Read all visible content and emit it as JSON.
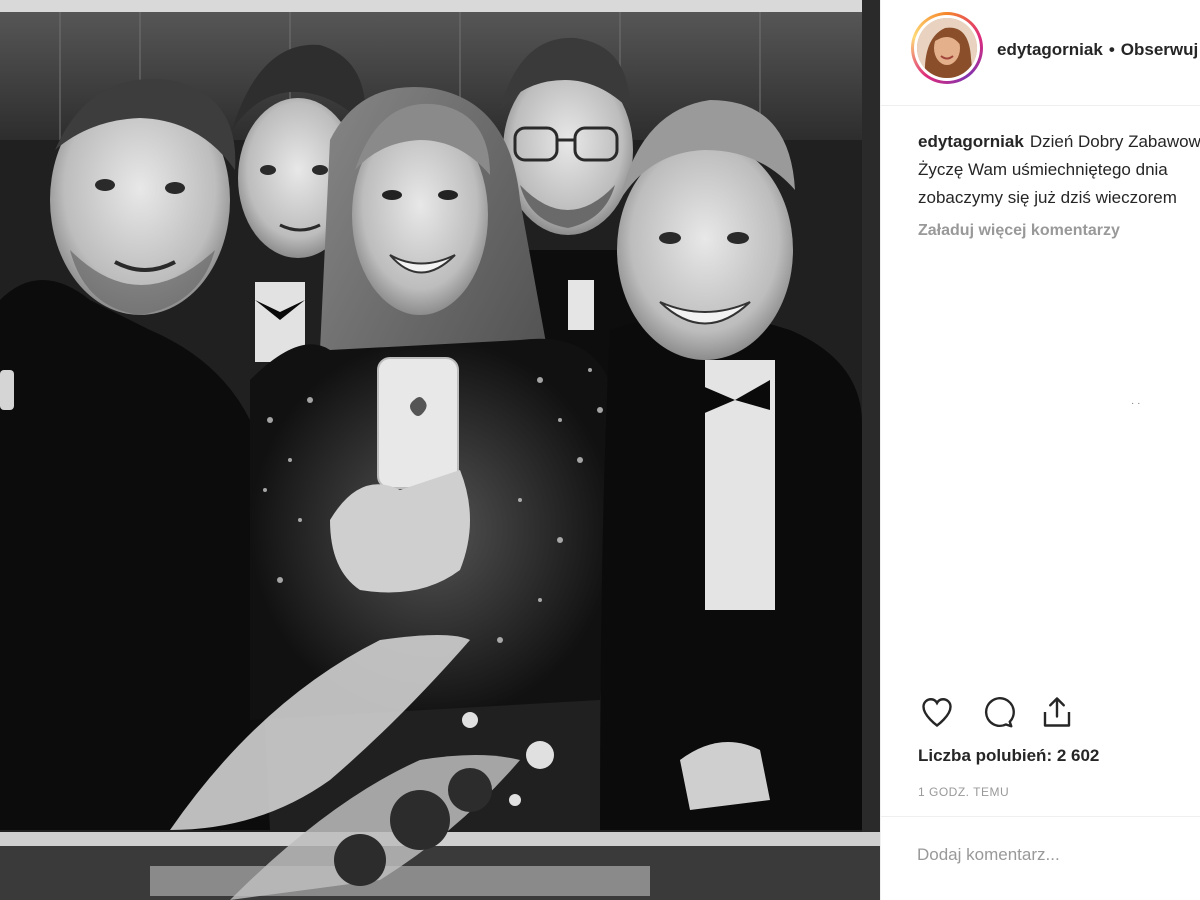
{
  "post": {
    "username": "edytagorniak",
    "separator": "•",
    "follow_label": "Obserwuj",
    "caption_lines": [
      "Dzień Dobry Zabawowicze",
      "Życzę Wam uśmiechniętego dnia",
      "zobaczymy się już dziś wieczorem"
    ],
    "load_more_label": "Załaduj więcej komentarzy",
    "likes_text": "Liczba polubień: 2 602",
    "time_text": "1 GODZ. TEMU",
    "comment_placeholder": "Dodaj komentarz..."
  },
  "icons": {
    "like": "heart-icon",
    "comment": "comment-bubble-icon",
    "share": "share-icon"
  },
  "colors": {
    "text": "#262626",
    "muted": "#999999",
    "border": "#efefef"
  }
}
